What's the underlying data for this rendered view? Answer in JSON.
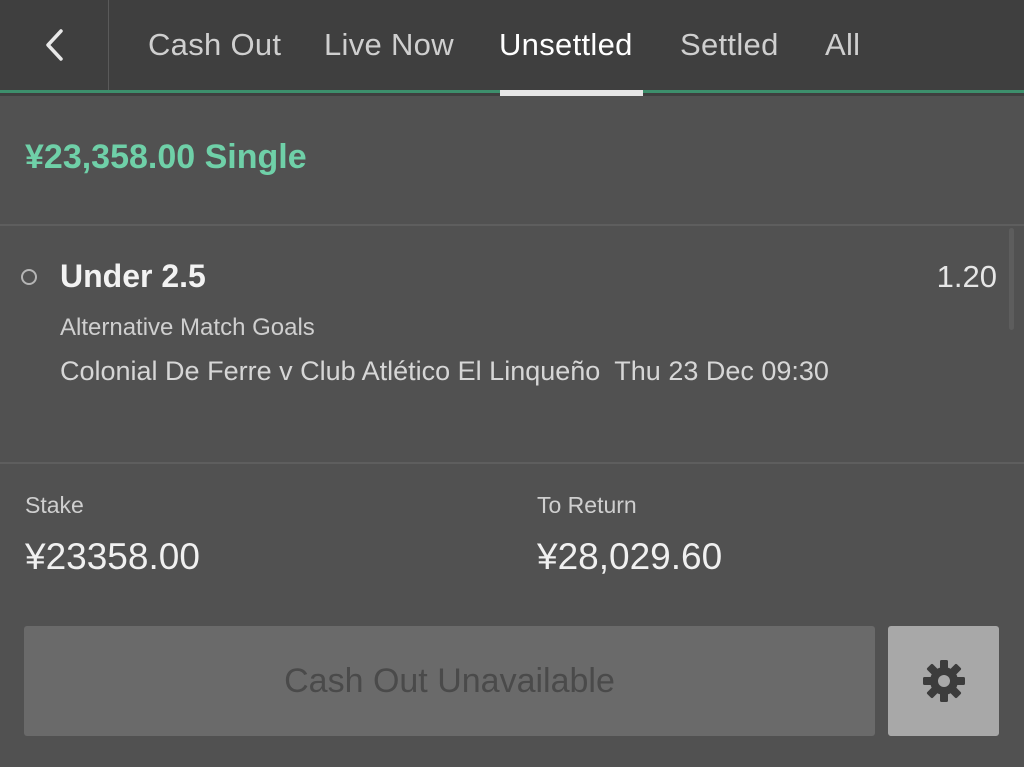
{
  "nav": {
    "back_icon": "chevron-left-icon",
    "tabs": [
      {
        "label": "Cash Out",
        "active": false
      },
      {
        "label": "Live Now",
        "active": false
      },
      {
        "label": "Unsettled",
        "active": true
      },
      {
        "label": "Settled",
        "active": false
      },
      {
        "label": "All",
        "active": false
      }
    ]
  },
  "bet": {
    "title": "¥23,358.00 Single",
    "selection": {
      "name": "Under 2.5",
      "odds": "1.20",
      "market": "Alternative Match Goals",
      "event": "Colonial De Ferre v Club Atlético El Linqueño",
      "datetime": "Thu 23 Dec 09:30"
    },
    "stake_label": "Stake",
    "stake_value": "¥23358.00",
    "return_label": "To Return",
    "return_value": "¥28,029.60",
    "cashout_button": "Cash Out Unavailable",
    "settings_icon": "gear-icon"
  },
  "colors": {
    "accent": "#6fd0a8",
    "nav_line": "#3d8f6c",
    "background": "#515151",
    "nav_background": "#3f3f3f"
  }
}
